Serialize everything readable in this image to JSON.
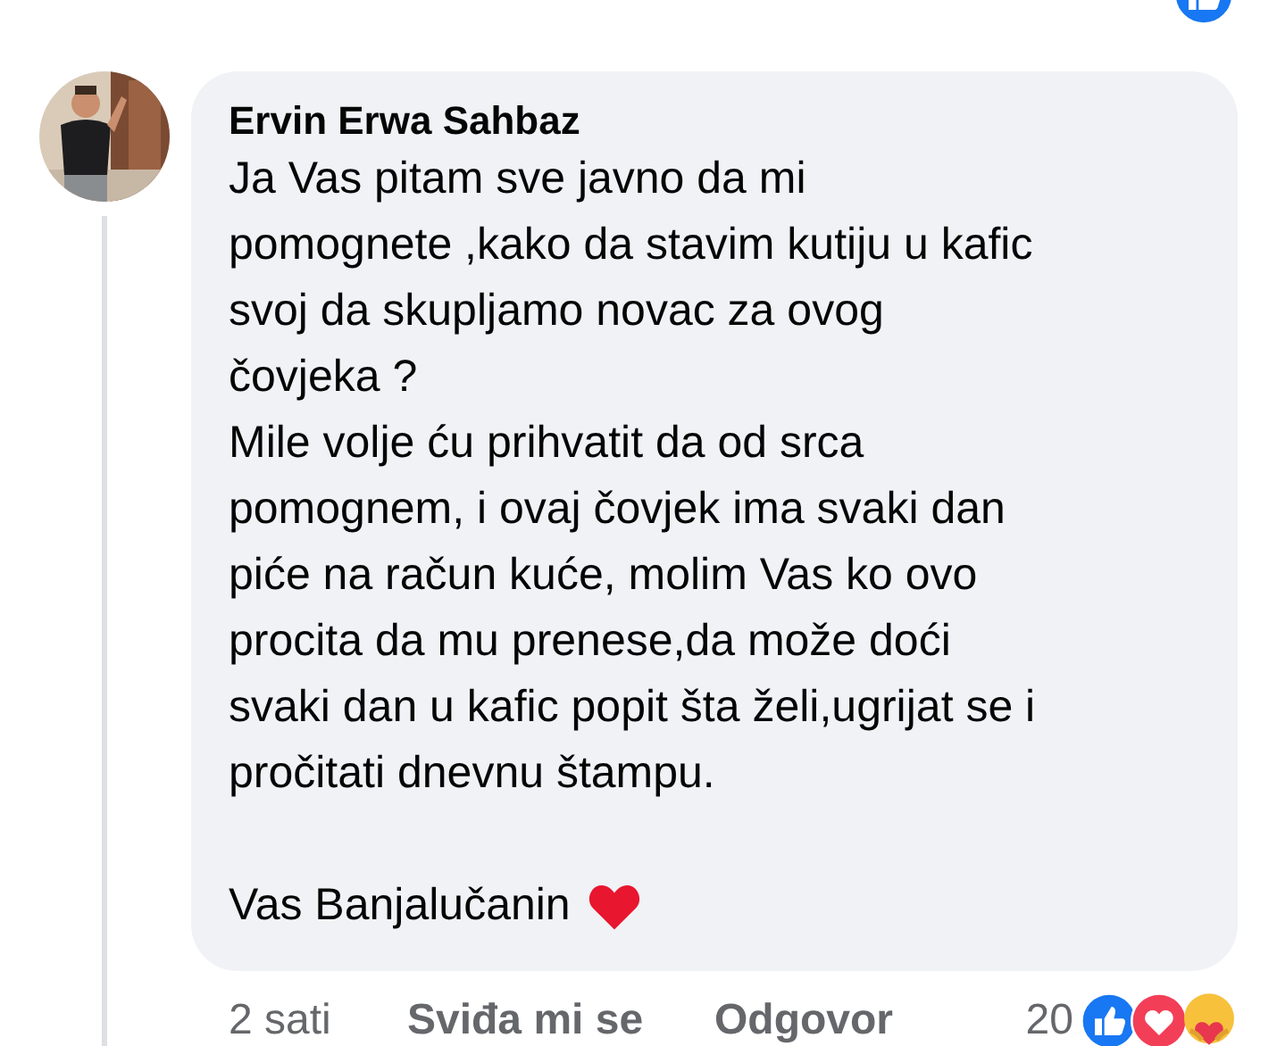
{
  "comment": {
    "author": "Ervin Erwa Sahbaz",
    "paragraphs": [
      "Ja Vas pitam sve javno da mi\npomognete ,kako da stavim kutiju u kafic\nsvoj da skupljamo novac za ovog\nčovjeka ?\nMile volje ću prihvatit da od srca\npomognem, i ovaj čovjek ima svaki dan\npiće na račun kuće, molim Vas ko ovo\nprocita da mu prenese,da može doći\nsvaki dan u kafic popit šta želi,ugrijat se i\npročitati dnevnu štampu."
    ],
    "signature": "Vas Banjalučanin",
    "actions": {
      "time": "2 sati",
      "like": "Sviđa mi se",
      "reply": "Odgovor",
      "reaction_count": "20"
    }
  }
}
